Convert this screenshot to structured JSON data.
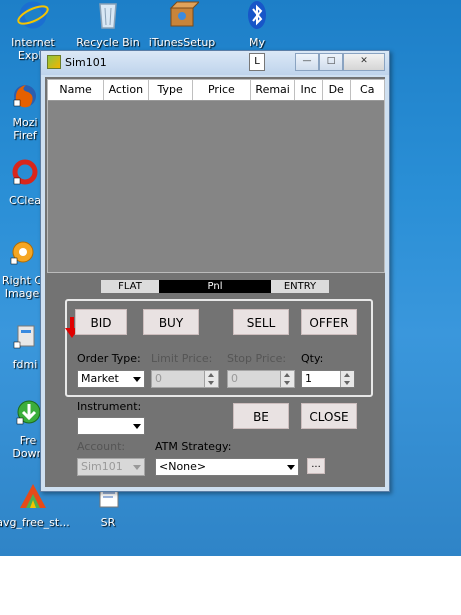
{
  "desktop": {
    "icons": [
      {
        "label_1": "Internet",
        "label_2": "Explo"
      },
      {
        "label_1": "Recycle Bin",
        "label_2": ""
      },
      {
        "label_1": "iTunesSetup",
        "label_2": ""
      },
      {
        "label_1": "My",
        "label_2": ""
      },
      {
        "label_1": "Mozi",
        "label_2": "Firef"
      },
      {
        "label_1": "CClea",
        "label_2": ""
      },
      {
        "label_1": "Right C",
        "label_2": "Image"
      },
      {
        "label_1": "fdmi",
        "label_2": ""
      },
      {
        "label_1": "Fre",
        "label_2": "Down"
      },
      {
        "label_1": "avg_free_st...",
        "label_2": ""
      },
      {
        "label_1": "SR",
        "label_2": ""
      }
    ]
  },
  "window": {
    "title": "Sim101",
    "l_button": "L",
    "columns": [
      "Name",
      "Action",
      "Type",
      "Price",
      "Remai",
      "Inc",
      "De",
      "Ca"
    ],
    "pnl": {
      "flat": "FLAT",
      "value": "Pnl",
      "entry": "ENTRY"
    },
    "buttons": {
      "bid": "BID",
      "buy": "BUY",
      "sell": "SELL",
      "offer": "OFFER",
      "be": "BE",
      "close": "CLOSE",
      "atm_more": "..."
    },
    "labels": {
      "order_type": "Order Type:",
      "limit_price": "Limit Price:",
      "stop_price": "Stop Price:",
      "qty": "Qty:",
      "instrument": "Instrument:",
      "account": "Account:",
      "atm_strategy": "ATM Strategy:"
    },
    "values": {
      "order_type": "Market",
      "limit_price": "0",
      "stop_price": "0",
      "qty": "1",
      "instrument": "",
      "account": "Sim101",
      "atm_strategy": "<None>"
    }
  }
}
